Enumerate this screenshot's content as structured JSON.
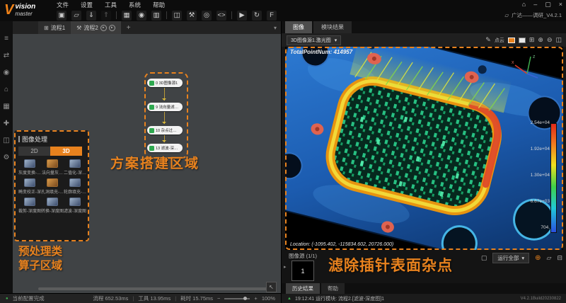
{
  "colors": {
    "accent": "#e8821e",
    "node_green": "#2ea84f",
    "status_green": "#3fae4f",
    "canvas_gray": "#404345"
  },
  "window": {
    "logo_v": "V",
    "logo_line1": "vision",
    "logo_line2": "master",
    "project": "广达——调研_V4.2.1",
    "controls": [
      {
        "name": "home-icon",
        "glyph": "⌂"
      },
      {
        "name": "minimize-icon",
        "glyph": "–"
      },
      {
        "name": "maximize-icon",
        "glyph": "▢"
      },
      {
        "name": "close-icon",
        "glyph": "×"
      }
    ]
  },
  "menubar": {
    "items": [
      "文件",
      "设置",
      "工具",
      "系统",
      "帮助"
    ]
  },
  "toolbar": {
    "icons": [
      {
        "name": "save-icon",
        "glyph": "▣"
      },
      {
        "name": "open-icon",
        "glyph": "▱"
      },
      {
        "name": "import-icon",
        "glyph": "⇓"
      },
      {
        "name": "export-icon",
        "glyph": "⇑"
      },
      {
        "name": "image-source-icon",
        "glyph": "▦"
      },
      {
        "name": "camera-icon",
        "glyph": "◉"
      },
      {
        "name": "film-icon",
        "glyph": "▥"
      },
      {
        "name": "module-icon",
        "glyph": "◫"
      },
      {
        "name": "tools-icon",
        "glyph": "⚒"
      },
      {
        "name": "global-icon",
        "glyph": "◎"
      },
      {
        "name": "code-icon",
        "glyph": "<>"
      },
      {
        "name": "run-once-icon",
        "glyph": "▶"
      },
      {
        "name": "run-loop-icon",
        "glyph": "↻"
      },
      {
        "name": "format-icon",
        "glyph": "F"
      }
    ]
  },
  "left_strip": {
    "icons": [
      {
        "name": "workflow-icon",
        "glyph": "≡"
      },
      {
        "name": "io-icon",
        "glyph": "⇄"
      },
      {
        "name": "camera-icon",
        "glyph": "◉"
      },
      {
        "name": "comm-icon",
        "glyph": "⌂"
      },
      {
        "name": "variable-icon",
        "glyph": "▦"
      },
      {
        "name": "script-icon",
        "glyph": "✚"
      },
      {
        "name": "display-icon",
        "glyph": "◫"
      },
      {
        "name": "settings-icon",
        "glyph": "⚙"
      }
    ]
  },
  "flow": {
    "tab1": "流程1",
    "tab2": "流程2",
    "add": "+",
    "chevron": "▾",
    "tab1_icon": "⊞",
    "tab2_icon": "⚒",
    "run_glyph": "▸",
    "nodes": [
      {
        "label": "0 3D图像源1"
      },
      {
        "label": "9 法向量滤…"
      },
      {
        "label": "10 杂点过…"
      },
      {
        "label": "13 滤波-深…"
      }
    ],
    "annotation_build": "方案搭建区域",
    "annotation_op_line1": "预处理类",
    "annotation_op_line2": "算子区域",
    "locate_glyph": "↖"
  },
  "operator_panel": {
    "title": "图像处理",
    "tab_2d": "2D",
    "tab_3d": "3D",
    "operators": [
      {
        "label": "灰度变换-…"
      },
      {
        "label": "法向量灰…"
      },
      {
        "label": "二值化-深…"
      },
      {
        "label": "畸变校正-深…"
      },
      {
        "label": "孔洞填充-…"
      },
      {
        "label": "轮廓填充-…"
      },
      {
        "label": "裁剪-深度图"
      },
      {
        "label": "转换-深度图"
      },
      {
        "label": "滤波-深度图"
      }
    ]
  },
  "viewer": {
    "tab_image": "图像",
    "tab_result": "模块结果",
    "source_select": "3D图像源1.激光图",
    "select_chevron": "▾",
    "pencil_glyph": "✎",
    "pointcloud_label": "点云",
    "fit_glyph": "⊞",
    "zoom_in_glyph": "⊕",
    "zoom_out_glyph": "⊖",
    "layout_glyph": "◫",
    "overlay_top": "TotalPointNum: 414957",
    "overlay_bottom": "Location: (-1095.402, -115834.602, 20726.000)",
    "colorbar_labels": [
      "2.54e+04",
      "1.92e+04",
      "1.30e+04",
      "6.67e+03",
      "704."
    ],
    "axis_x": "x",
    "axis_z": "z"
  },
  "filmstrip": {
    "source_label": "图像源 (1/1)",
    "expand_glyph": "▸",
    "thumb_label": "1",
    "annotation": "滤除插针表面杂点",
    "capture_glyph": "▢",
    "run_all": "运行全部",
    "run_all_chevron": "▾",
    "add_glyph": "⊕",
    "folder_glyph": "▱",
    "delete_glyph": "⊟"
  },
  "bottom_panel": {
    "tab_history": "历史结果",
    "tab_help": "帮助",
    "log_glyph": "▲",
    "log": "19:12:41 运行模块: 流程2.[滤波-深度图]1",
    "version": "V4.2.1Build20230822"
  },
  "statusbar": {
    "status_glyph": "●",
    "status": "当前配置完成",
    "metrics": [
      "流程 652.53ms",
      "工具 13.95ms",
      "耗时 15.75ms"
    ],
    "minus": "−",
    "plus": "+",
    "zoom": "100%"
  }
}
